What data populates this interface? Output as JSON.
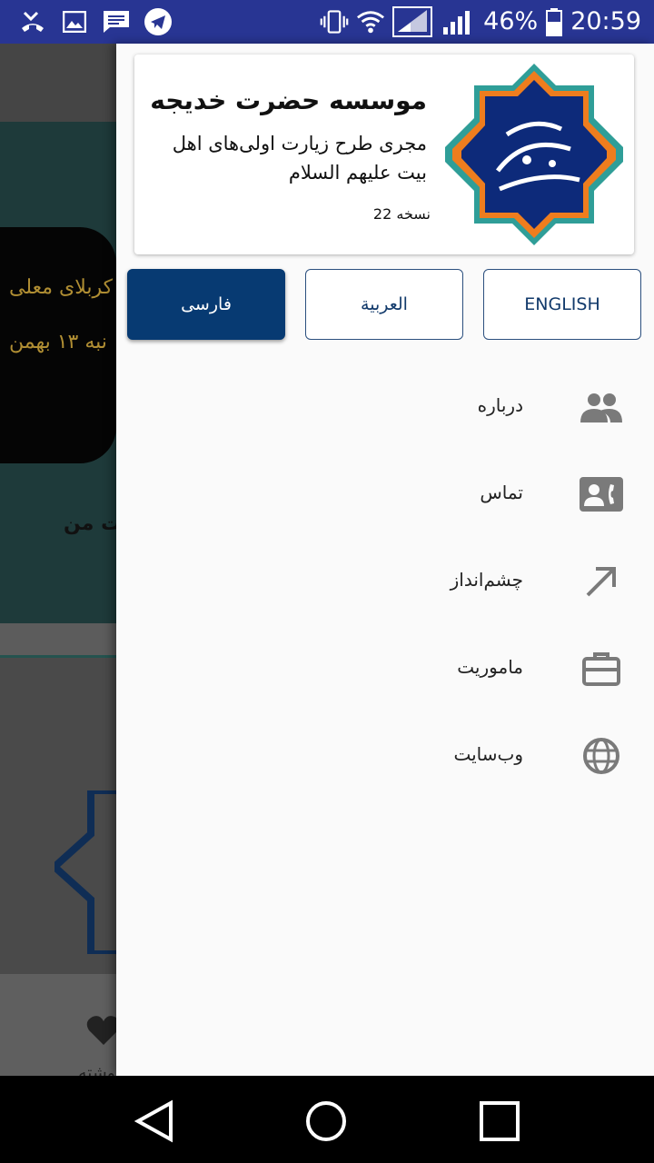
{
  "status_bar": {
    "battery_percent": "46%",
    "time": "20:59",
    "left_icons": [
      "missed-call-icon",
      "image-icon",
      "message-icon",
      "telegram-icon"
    ],
    "right_icons": [
      "vibrate-icon",
      "wifi-icon",
      "signal-icon",
      "signal-icon",
      "battery-icon"
    ]
  },
  "background": {
    "banner_text": "ی کربلای معلی",
    "banner_text_2": "نبه ۱۳ بهمن",
    "caption": "ست من",
    "tab_label": "نوشته"
  },
  "drawer": {
    "header": {
      "title": "موسسه حضرت خدیجه",
      "subtitle": "مجری طرح زیارت اولی‌های اهل بیت علیهم السلام",
      "version": "نسخه 22"
    },
    "languages": [
      {
        "label": "ENGLISH",
        "active": false
      },
      {
        "label": "العربية",
        "active": false
      },
      {
        "label": "فارسی",
        "active": true
      }
    ],
    "menu": [
      {
        "label": "درباره",
        "icon": "people-icon"
      },
      {
        "label": "تماس",
        "icon": "contact-phone-icon"
      },
      {
        "label": "چشم‌انداز",
        "icon": "arrow-up-right-icon"
      },
      {
        "label": "ماموریت",
        "icon": "briefcase-icon"
      },
      {
        "label": "وب‌سایت",
        "icon": "globe-icon"
      }
    ]
  },
  "colors": {
    "status_bar": "#283593",
    "accent": "#073a72",
    "icon_gray": "#7a7a7a"
  }
}
